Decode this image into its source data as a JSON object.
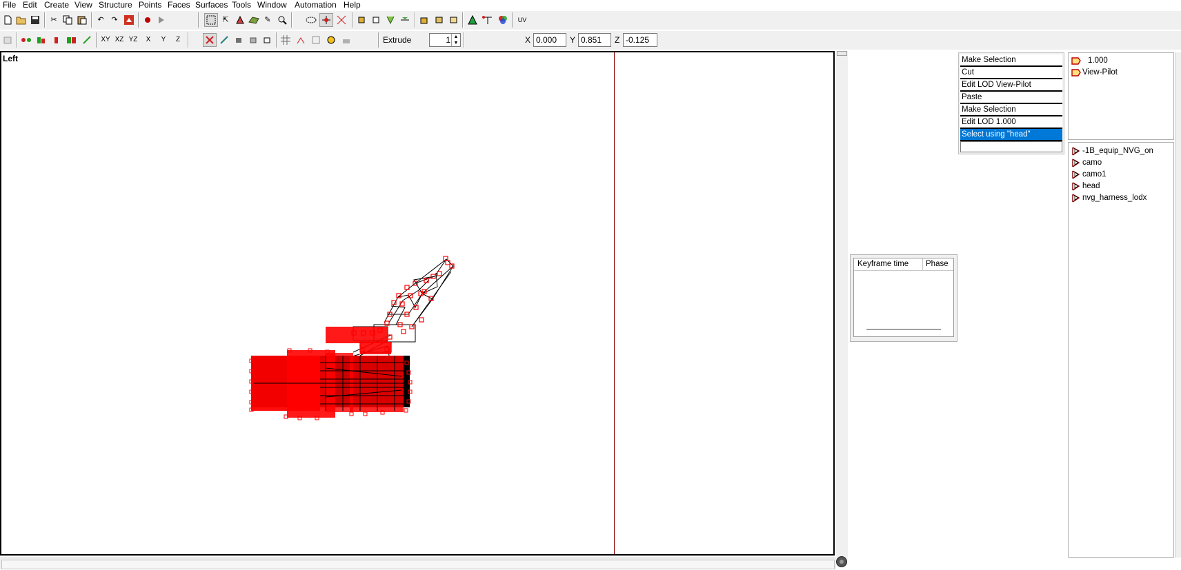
{
  "menu": [
    "File",
    "Edit",
    "Create",
    "View",
    "Structure",
    "Points",
    "Faces",
    "Surfaces",
    "Tools",
    "Window",
    "Automation",
    "Help"
  ],
  "toolbar": {
    "axis_buttons": [
      "XY",
      "XZ",
      "YZ",
      "X",
      "Y",
      "Z"
    ],
    "uv_label": "UV",
    "extrude_label": "Extrude",
    "extrude_value": "1",
    "coord_x_label": "X",
    "coord_x_value": "0.000",
    "coord_y_label": "Y",
    "coord_y_value": "0.851",
    "coord_z_label": "Z",
    "coord_z_value": "-0.125"
  },
  "viewport": {
    "label": "Left"
  },
  "history": {
    "items": [
      "Make Selection",
      "Cut",
      "Edit LOD View-Pilot",
      "Paste",
      "Make Selection",
      "Edit LOD   1.000",
      "Select using \"head\""
    ],
    "active_index": 6
  },
  "lods": [
    "1.000",
    "View-Pilot"
  ],
  "selections": [
    "-1B_equip_NVG_on",
    "camo",
    "camo1",
    "head",
    "nvg_harness_lodx"
  ],
  "keyframes": {
    "col_time": "Keyframe time",
    "col_phase": "Phase"
  },
  "colors": {
    "vertex": "#ff0000",
    "active": "#0078d7",
    "axis_line": "#8b0000"
  }
}
